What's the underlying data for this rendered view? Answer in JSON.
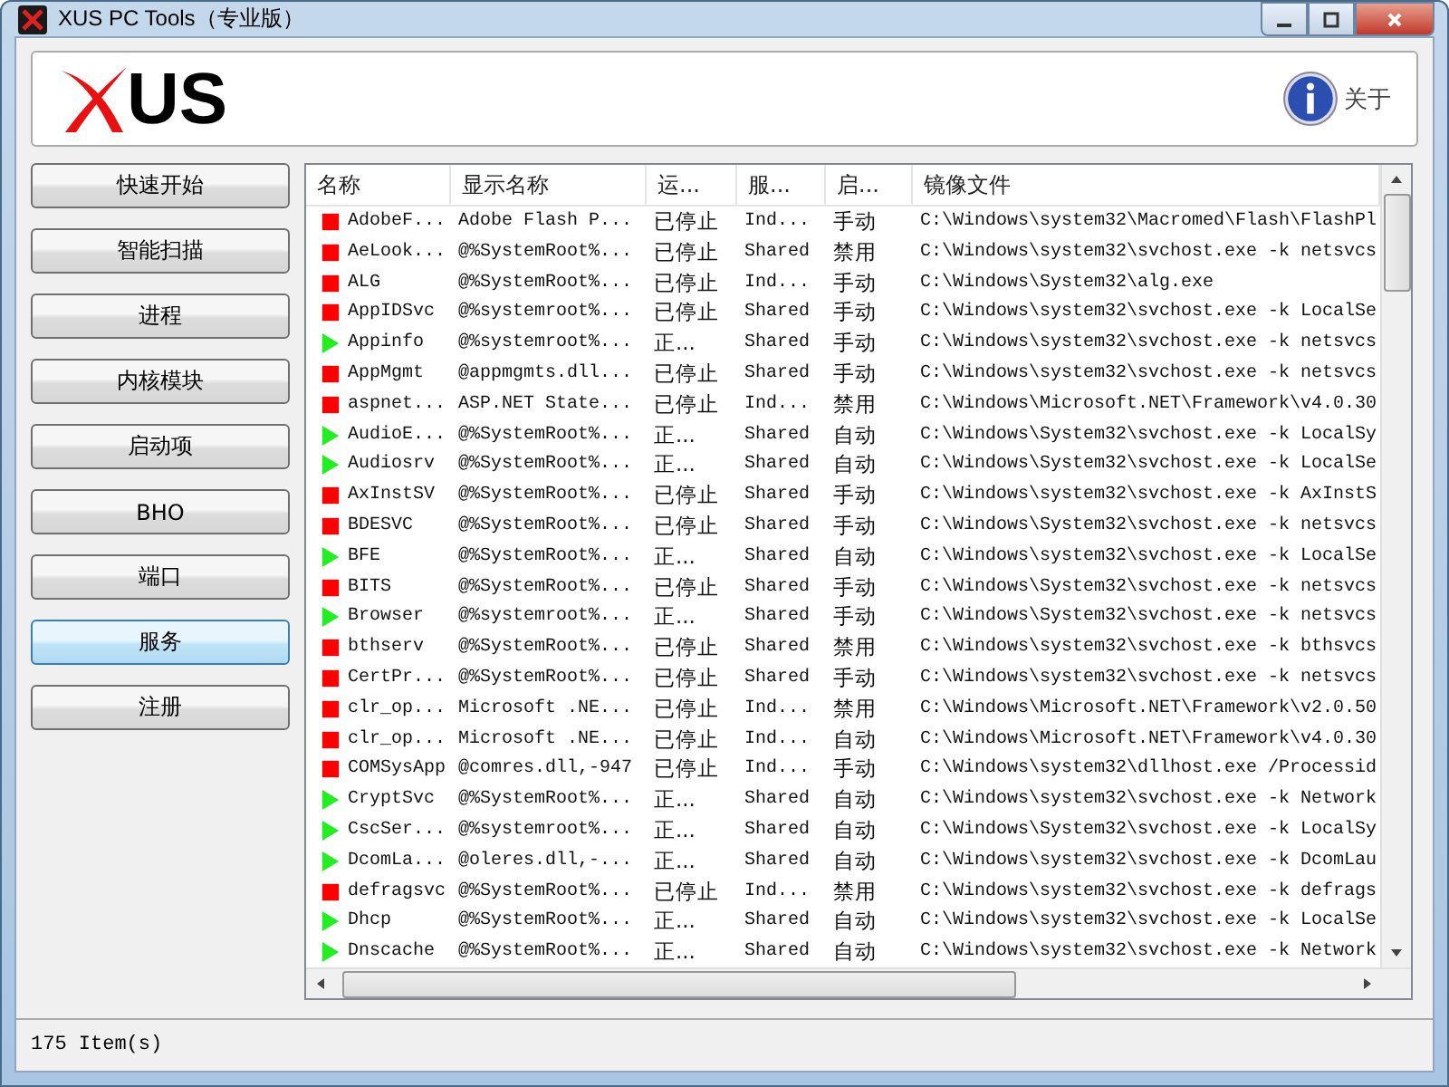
{
  "window": {
    "title": "XUS PC Tools（专业版）"
  },
  "header": {
    "logo_text": "US",
    "about": "关于"
  },
  "sidebar": {
    "items": [
      {
        "label": "快速开始",
        "selected": false
      },
      {
        "label": "智能扫描",
        "selected": false
      },
      {
        "label": "进程",
        "selected": false
      },
      {
        "label": "内核模块",
        "selected": false
      },
      {
        "label": "启动项",
        "selected": false
      },
      {
        "label": "BHO",
        "selected": false
      },
      {
        "label": "端口",
        "selected": false
      },
      {
        "label": "服务",
        "selected": true
      },
      {
        "label": "注册",
        "selected": false
      }
    ]
  },
  "table": {
    "columns": [
      "名称",
      "显示名称",
      "运...",
      "服...",
      "启...",
      "镜像文件"
    ],
    "rows": [
      {
        "running": false,
        "cells": [
          "AdobeF...",
          "Adobe Flash P...",
          "已停止",
          "Ind...",
          "手动",
          "C:\\Windows\\system32\\Macromed\\Flash\\FlashPl"
        ]
      },
      {
        "running": false,
        "cells": [
          "AeLook...",
          "@%SystemRoot%...",
          "已停止",
          "Shared",
          "禁用",
          "C:\\Windows\\system32\\svchost.exe -k netsvcs"
        ]
      },
      {
        "running": false,
        "cells": [
          "ALG",
          "@%SystemRoot%...",
          "已停止",
          "Ind...",
          "手动",
          "C:\\Windows\\System32\\alg.exe"
        ]
      },
      {
        "running": false,
        "cells": [
          "AppIDSvc",
          "@%systemroot%...",
          "已停止",
          "Shared",
          "手动",
          "C:\\Windows\\system32\\svchost.exe -k LocalSe"
        ]
      },
      {
        "running": true,
        "cells": [
          "Appinfo",
          "@%systemroot%...",
          "正...",
          "Shared",
          "手动",
          "C:\\Windows\\system32\\svchost.exe -k netsvcs"
        ]
      },
      {
        "running": false,
        "cells": [
          "AppMgmt",
          "@appmgmts.dll...",
          "已停止",
          "Shared",
          "手动",
          "C:\\Windows\\system32\\svchost.exe -k netsvcs"
        ]
      },
      {
        "running": false,
        "cells": [
          "aspnet...",
          "ASP.NET State...",
          "已停止",
          "Ind...",
          "禁用",
          "C:\\Windows\\Microsoft.NET\\Framework\\v4.0.30"
        ]
      },
      {
        "running": true,
        "cells": [
          "AudioE...",
          "@%SystemRoot%...",
          "正...",
          "Shared",
          "自动",
          "C:\\Windows\\System32\\svchost.exe -k LocalSy"
        ]
      },
      {
        "running": true,
        "cells": [
          "Audiosrv",
          "@%SystemRoot%...",
          "正...",
          "Shared",
          "自动",
          "C:\\Windows\\System32\\svchost.exe -k LocalSe"
        ]
      },
      {
        "running": false,
        "cells": [
          "AxInstSV",
          "@%SystemRoot%...",
          "已停止",
          "Shared",
          "手动",
          "C:\\Windows\\system32\\svchost.exe -k AxInstS"
        ]
      },
      {
        "running": false,
        "cells": [
          "BDESVC",
          "@%SystemRoot%...",
          "已停止",
          "Shared",
          "手动",
          "C:\\Windows\\System32\\svchost.exe -k netsvcs"
        ]
      },
      {
        "running": true,
        "cells": [
          "BFE",
          "@%SystemRoot%...",
          "正...",
          "Shared",
          "自动",
          "C:\\Windows\\system32\\svchost.exe -k LocalSe"
        ]
      },
      {
        "running": false,
        "cells": [
          "BITS",
          "@%SystemRoot%...",
          "已停止",
          "Shared",
          "手动",
          "C:\\Windows\\System32\\svchost.exe -k netsvcs"
        ]
      },
      {
        "running": true,
        "cells": [
          "Browser",
          "@%systemroot%...",
          "正...",
          "Shared",
          "手动",
          "C:\\Windows\\System32\\svchost.exe -k netsvcs"
        ]
      },
      {
        "running": false,
        "cells": [
          "bthserv",
          "@%SystemRoot%...",
          "已停止",
          "Shared",
          "禁用",
          "C:\\Windows\\system32\\svchost.exe -k bthsvcs"
        ]
      },
      {
        "running": false,
        "cells": [
          "CertPr...",
          "@%SystemRoot%...",
          "已停止",
          "Shared",
          "手动",
          "C:\\Windows\\system32\\svchost.exe -k netsvcs"
        ]
      },
      {
        "running": false,
        "cells": [
          "clr_op...",
          "Microsoft .NE...",
          "已停止",
          "Ind...",
          "禁用",
          "C:\\Windows\\Microsoft.NET\\Framework\\v2.0.50"
        ]
      },
      {
        "running": false,
        "cells": [
          "clr_op...",
          "Microsoft .NE...",
          "已停止",
          "Ind...",
          "自动",
          "C:\\Windows\\Microsoft.NET\\Framework\\v4.0.30"
        ]
      },
      {
        "running": false,
        "cells": [
          "COMSysApp",
          "@comres.dll,-947",
          "已停止",
          "Ind...",
          "手动",
          "C:\\Windows\\system32\\dllhost.exe /Processid"
        ]
      },
      {
        "running": true,
        "cells": [
          "CryptSvc",
          "@%SystemRoot%...",
          "正...",
          "Shared",
          "自动",
          "C:\\Windows\\system32\\svchost.exe -k Network"
        ]
      },
      {
        "running": true,
        "cells": [
          "CscSer...",
          "@%systemroot%...",
          "正...",
          "Shared",
          "自动",
          "C:\\Windows\\System32\\svchost.exe -k LocalSy"
        ]
      },
      {
        "running": true,
        "cells": [
          "DcomLa...",
          "@oleres.dll,-...",
          "正...",
          "Shared",
          "自动",
          "C:\\Windows\\system32\\svchost.exe -k DcomLau"
        ]
      },
      {
        "running": false,
        "cells": [
          "defragsvc",
          "@%SystemRoot%...",
          "已停止",
          "Ind...",
          "禁用",
          "C:\\Windows\\system32\\svchost.exe -k defrags"
        ]
      },
      {
        "running": true,
        "cells": [
          "Dhcp",
          "@%SystemRoot%...",
          "正...",
          "Shared",
          "自动",
          "C:\\Windows\\system32\\svchost.exe -k LocalSe"
        ]
      },
      {
        "running": true,
        "cells": [
          "Dnscache",
          "@%SystemRoot%...",
          "正...",
          "Shared",
          "自动",
          "C:\\Windows\\system32\\svchost.exe -k Network"
        ]
      }
    ]
  },
  "status_bar": {
    "text": "175 Item(s)"
  }
}
